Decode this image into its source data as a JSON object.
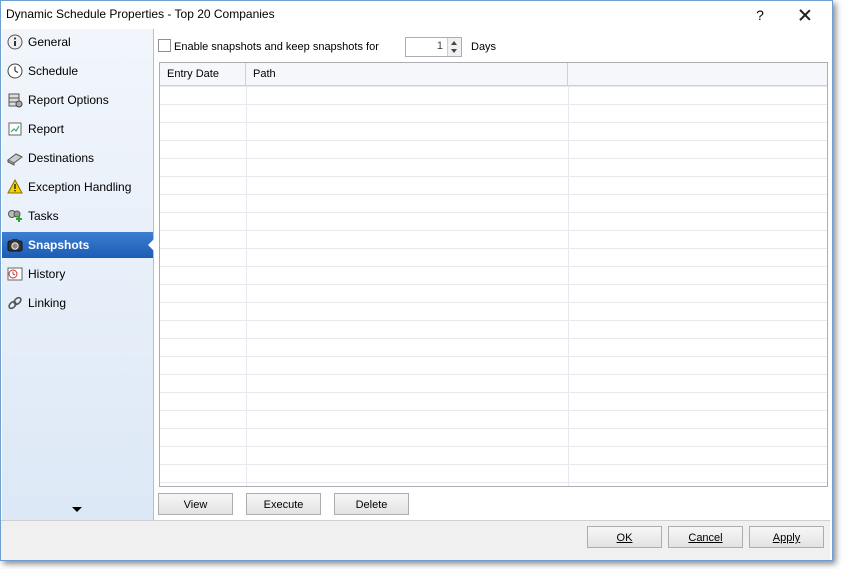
{
  "window": {
    "title": "Dynamic Schedule Properties - Top 20 Companies",
    "help_label": "?"
  },
  "sidebar": {
    "items": [
      {
        "label": "General",
        "icon": "info-icon"
      },
      {
        "label": "Schedule",
        "icon": "clock-icon"
      },
      {
        "label": "Report Options",
        "icon": "database-icon"
      },
      {
        "label": "Report",
        "icon": "report-icon"
      },
      {
        "label": "Destinations",
        "icon": "destinations-icon"
      },
      {
        "label": "Exception Handling",
        "icon": "warning-icon"
      },
      {
        "label": "Tasks",
        "icon": "tasks-icon"
      },
      {
        "label": "Snapshots",
        "icon": "camera-icon"
      },
      {
        "label": "History",
        "icon": "history-icon"
      },
      {
        "label": "Linking",
        "icon": "link-icon"
      }
    ],
    "active_index": 7
  },
  "snapshots": {
    "enable_label": "Enable snapshots and keep snapshots for",
    "enabled": false,
    "days_value": "1",
    "days_label": "Days",
    "columns": [
      "Entry Date",
      "Path",
      ""
    ],
    "rows": [],
    "buttons": {
      "view": "View",
      "execute": "Execute",
      "delete": "Delete"
    }
  },
  "footer": {
    "ok": "OK",
    "cancel": "Cancel",
    "apply": "Apply"
  },
  "colors": {
    "accent": "#1b5cb5",
    "sidebar_bg": "#dce8f6",
    "border": "#6d9fd0"
  }
}
